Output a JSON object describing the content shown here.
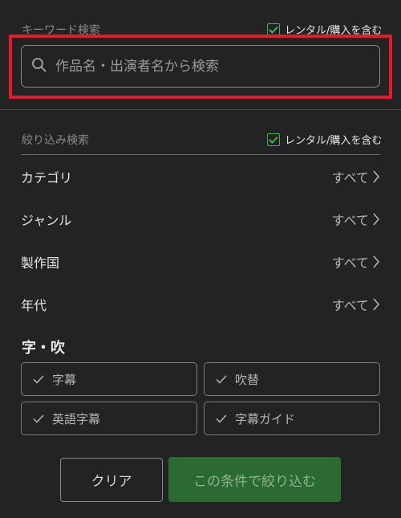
{
  "keyword": {
    "label": "キーワード検索",
    "include_rental_label": "レンタル/購入を含む",
    "search_placeholder": "作品名・出演者名から検索",
    "search_value": ""
  },
  "filter": {
    "label": "絞り込み検索",
    "include_rental_label": "レンタル/購入を含む",
    "rows": [
      {
        "name": "カテゴリ",
        "value": "すべて"
      },
      {
        "name": "ジャンル",
        "value": "すべて"
      },
      {
        "name": "製作国",
        "value": "すべて"
      },
      {
        "name": "年代",
        "value": "すべて"
      }
    ]
  },
  "audio": {
    "title": "字・吹",
    "options": [
      "字幕",
      "吹替",
      "英語字幕",
      "字幕ガイド"
    ]
  },
  "actions": {
    "clear_label": "クリア",
    "apply_label": "この条件で絞り込む"
  },
  "colors": {
    "accent_green": "#3fb34f",
    "highlight_red": "#e8192c",
    "apply_button": "#2b6a33",
    "background": "#232323"
  }
}
